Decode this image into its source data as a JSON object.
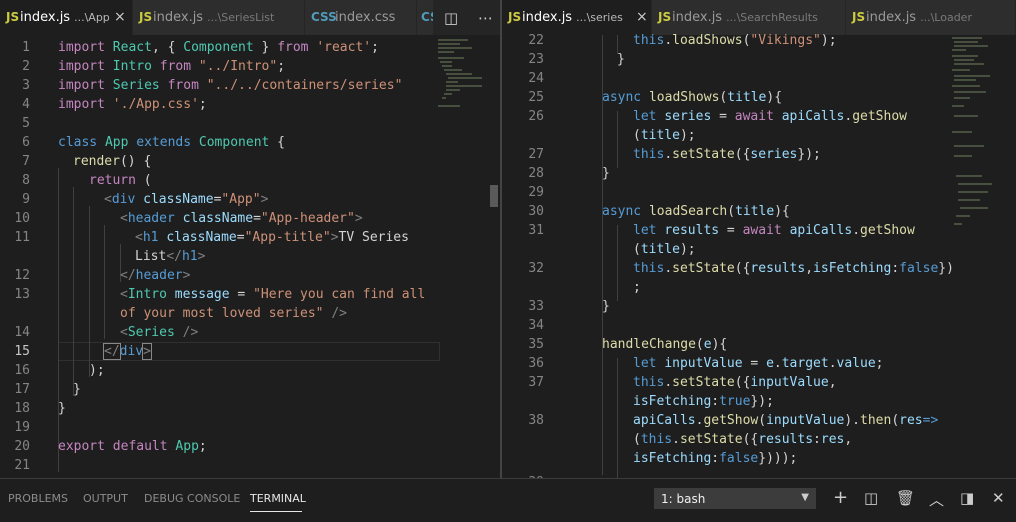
{
  "editor_left": {
    "tabs": [
      {
        "name": "index.js",
        "desc": "...\\App",
        "icon": "JS",
        "active": true
      },
      {
        "name": "index.js",
        "desc": "...\\SeriesList",
        "icon": "JS"
      },
      {
        "name": "index.css",
        "desc": "",
        "icon": "CSS"
      },
      {
        "name": "",
        "desc": "",
        "icon": "CSS"
      }
    ],
    "line_numbers": [
      "1",
      "2",
      "3",
      "4",
      "5",
      "6",
      "7",
      "8",
      "9",
      "10",
      "11",
      "",
      "12",
      "13",
      "",
      "14",
      "15",
      "16",
      "17",
      "18",
      "19",
      "20",
      "21"
    ],
    "active_line": "15"
  },
  "editor_right": {
    "tabs": [
      {
        "name": "index.js",
        "desc": "...\\series",
        "icon": "JS",
        "active": true
      },
      {
        "name": "index.js",
        "desc": "...\\SearchResults",
        "icon": "JS"
      },
      {
        "name": "index.js",
        "desc": "...\\Loader",
        "icon": "JS"
      }
    ],
    "line_numbers": [
      "22",
      "23",
      "24",
      "25",
      "26",
      "",
      "27",
      "28",
      "29",
      "30",
      "31",
      "",
      "32",
      "",
      "33",
      "34",
      "35",
      "36",
      "37",
      "",
      "38",
      "",
      "39"
    ]
  },
  "icons": {
    "close": "×",
    "split": "split-editor-icon",
    "more": "more-actions-icon"
  },
  "panel": {
    "tabs": [
      "PROBLEMS",
      "OUTPUT",
      "DEBUG CONSOLE",
      "TERMINAL"
    ],
    "active_tab": "TERMINAL",
    "terminal_select": "1: bash",
    "icons": [
      "plus-icon",
      "split-terminal-icon",
      "trash-icon",
      "chevron-up-icon",
      "maximize-panel-icon",
      "close-panel-icon"
    ]
  }
}
